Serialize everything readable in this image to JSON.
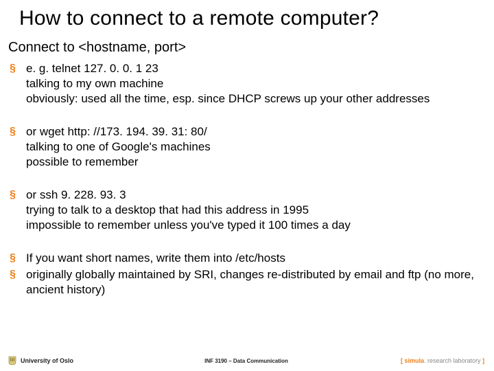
{
  "title": "How to connect to a remote computer?",
  "subtitle": "Connect to <hostname, port>",
  "bullets": [
    {
      "lines": [
        "e. g. telnet 127. 0. 0. 1 23",
        "talking to my own machine",
        "obviously: used all the time, esp. since DHCP screws up your other addresses"
      ],
      "tight": false
    },
    {
      "lines": [
        "or wget http: //173. 194. 39. 31: 80/",
        "talking to one of Google's machines",
        "possible to remember"
      ],
      "tight": false
    },
    {
      "lines": [
        "or ssh 9. 228. 93. 3",
        "trying to talk to a desktop that had this address in 1995",
        "impossible to remember unless you've typed it 100 times a day"
      ],
      "tight": false
    },
    {
      "lines": [
        "If you want short names, write them into /etc/hosts"
      ],
      "tight": true
    },
    {
      "lines": [
        "originally globally maintained by SRI, changes re-distributed by email and ftp (no more, ancient history)"
      ],
      "tight": false
    }
  ],
  "footer": {
    "left": "University of Oslo",
    "center": "INF 3190 – Data Communication",
    "right_brand": "simula",
    "right_tag": ". research laboratory"
  }
}
